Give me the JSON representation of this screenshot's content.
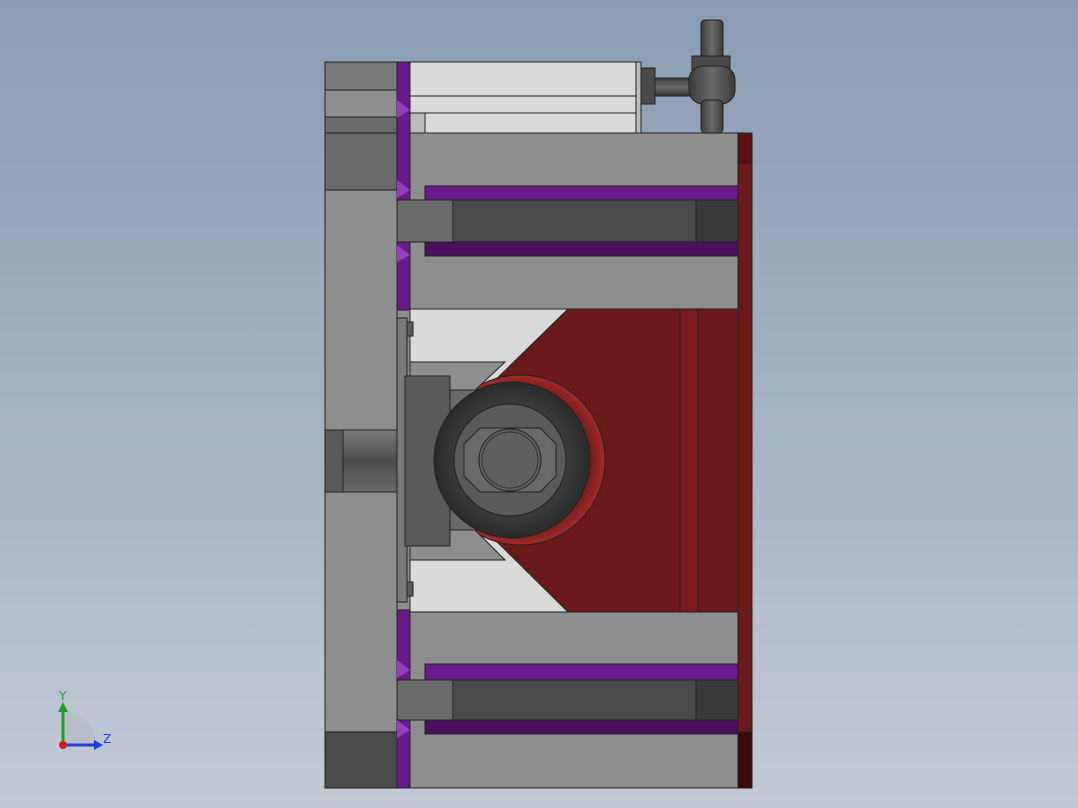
{
  "window": {
    "type": "CAD graphics viewport"
  },
  "colors": {
    "background_top": "#8a9db4",
    "background_bottom": "#c3cad5",
    "part_gray": "#8e8e8e",
    "part_dark_gray": "#4a4a4a",
    "part_darker_gray": "#393939",
    "part_light_gray": "#d9d9d9",
    "accent_purple": "#6b1a8a",
    "accent_dark_red": "#6b1a1a",
    "axis_x_red": "#d61a1a",
    "axis_y_green": "#1f9d2b",
    "axis_z_blue": "#1f3fd6"
  },
  "triad": {
    "y_label": "Y",
    "z_label": "Z"
  },
  "model_parts": [
    {
      "id": "base-plate",
      "icon": "plate-icon"
    },
    {
      "id": "cylinder-top",
      "icon": "cylinder-icon"
    },
    {
      "id": "elbow-fitting",
      "icon": "fitting-icon"
    },
    {
      "id": "upper-guide-block",
      "icon": "block-icon"
    },
    {
      "id": "lower-guide-block",
      "icon": "block-icon"
    },
    {
      "id": "clamp-arm",
      "icon": "arm-icon"
    },
    {
      "id": "roller-bearing",
      "icon": "bearing-icon"
    },
    {
      "id": "end-cap-plate",
      "icon": "plate-icon"
    }
  ]
}
